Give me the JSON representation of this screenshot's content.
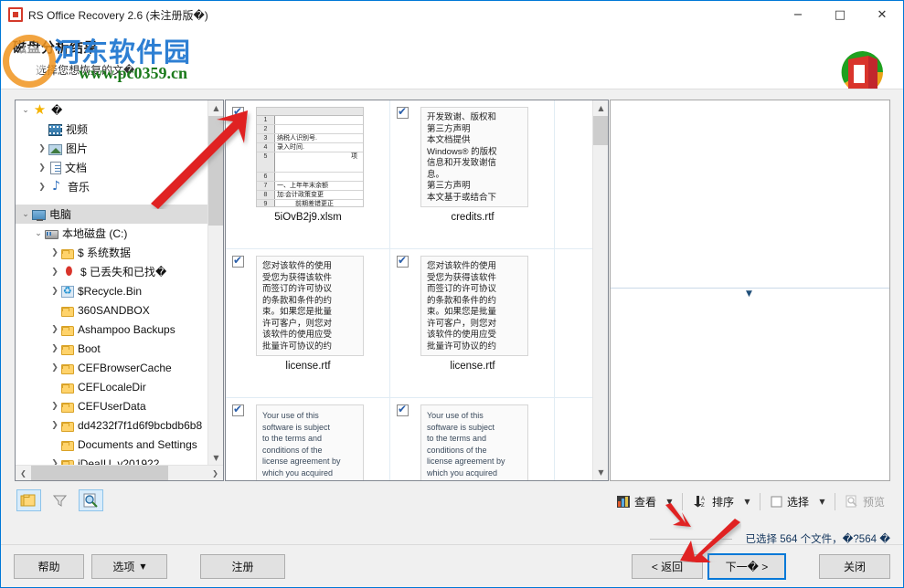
{
  "window": {
    "title": "RS Office Recovery 2.6 (未注册版�)",
    "icon": "office-recovery-icon",
    "minimize": "−",
    "maximize": "□",
    "close": "✕"
  },
  "header": {
    "title": "磁盘分析结果",
    "subtitle": "选择您想恢复的文�",
    "logo": "rs-office-recovery-logo"
  },
  "watermark": {
    "line1": "河东软件园",
    "line2": "www.pc0359.cn"
  },
  "tree": {
    "items": [
      {
        "label": "",
        "indent": 0,
        "chevron": "v",
        "icon": "star-icon",
        "selected": false,
        "unknown": "�"
      },
      {
        "label": "视频",
        "indent": 1,
        "chevron": "",
        "icon": "video-icon",
        "selected": false
      },
      {
        "label": "图片",
        "indent": 1,
        "chevron": ">",
        "icon": "picture-icon",
        "selected": false
      },
      {
        "label": "文档",
        "indent": 1,
        "chevron": ">",
        "icon": "document-icon",
        "selected": false
      },
      {
        "label": "音乐",
        "indent": 1,
        "chevron": ">",
        "icon": "music-icon",
        "selected": false
      },
      {
        "label": "电脑",
        "indent": 0,
        "chevron": "v",
        "icon": "computer-icon",
        "selected": true
      },
      {
        "label": "本地磁盘 (C:)",
        "indent": 1,
        "chevron": "v",
        "icon": "disk-icon",
        "selected": false
      },
      {
        "label": "$ 系统数据",
        "indent": 2,
        "chevron": ">",
        "icon": "folder-icon",
        "selected": false
      },
      {
        "label": "$ 已丢失和已找�",
        "indent": 2,
        "chevron": ">",
        "icon": "puzzle-icon",
        "selected": false
      },
      {
        "label": "$Recycle.Bin",
        "indent": 2,
        "chevron": ">",
        "icon": "recycle-bin-icon",
        "selected": false
      },
      {
        "label": "360SANDBOX",
        "indent": 2,
        "chevron": "",
        "icon": "folder-icon",
        "selected": false
      },
      {
        "label": "Ashampoo Backups",
        "indent": 2,
        "chevron": ">",
        "icon": "folder-icon",
        "selected": false
      },
      {
        "label": "Boot",
        "indent": 2,
        "chevron": ">",
        "icon": "folder-icon",
        "selected": false
      },
      {
        "label": "CEFBrowserCache",
        "indent": 2,
        "chevron": ">",
        "icon": "folder-icon",
        "selected": false
      },
      {
        "label": "CEFLocaleDir",
        "indent": 2,
        "chevron": "",
        "icon": "folder-icon",
        "selected": false
      },
      {
        "label": "CEFUserData",
        "indent": 2,
        "chevron": ">",
        "icon": "folder-icon",
        "selected": false
      },
      {
        "label": "dd4232f7f1d6f9bcbdb6b8",
        "indent": 2,
        "chevron": ">",
        "icon": "folder-icon",
        "selected": false
      },
      {
        "label": "Documents and Settings",
        "indent": 2,
        "chevron": "",
        "icon": "folder-icon",
        "selected": false
      },
      {
        "label": "iDeaIU_v201922",
        "indent": 2,
        "chevron": ">",
        "icon": "folder-icon",
        "selected": false
      }
    ]
  },
  "thumbnails": [
    {
      "name": "5iOvB2j9.xlsm",
      "type": "excel",
      "checked": true,
      "rows": [
        {
          "n": "1",
          "text": ""
        },
        {
          "n": "2",
          "text": ""
        },
        {
          "n": "3",
          "text": "纳税人识别号."
        },
        {
          "n": "4",
          "text": "录入时间."
        },
        {
          "n": "5",
          "text": ""
        },
        {
          "n": "6",
          "text": "项",
          "align": "right"
        },
        {
          "n": "7",
          "text": "一、上年年末余额"
        },
        {
          "n": "8",
          "text": "加:会计政策变更"
        },
        {
          "n": "9",
          "text": "前期差错更正",
          "align": "indent"
        }
      ]
    },
    {
      "name": "credits.rtf",
      "type": "text-cn",
      "checked": true,
      "text": "开发致谢、版权和\n第三方声明\n本文档提供\nWindows® 的版权\n信息和开发致谢信\n息。\n第三方声明\n本文基于或结合下"
    },
    {
      "name": "license.rtf",
      "type": "text-cn",
      "checked": true,
      "text": "您对该软件的使用\n受您为获得该软件\n而签订的许可协议\n的条款和条件的约\n束。如果您是批量\n许可客户，则您对\n该软件的使用应受\n批量许可协议的约"
    },
    {
      "name": "license.rtf",
      "type": "text-cn",
      "checked": true,
      "text": "您对该软件的使用\n受您为获得该软件\n而签订的许可协议\n的条款和条件的约\n束。如果您是批量\n许可客户，则您对\n该软件的使用应受\n批量许可协议的约"
    },
    {
      "name": "",
      "type": "text-en",
      "checked": true,
      "text": "Your use of this\nsoftware is subject\nto the terms and\nconditions of the\nlicense agreement by\nwhich you acquired"
    },
    {
      "name": "",
      "type": "text-en",
      "checked": true,
      "text": "Your use of this\nsoftware is subject\nto the terms and\nconditions of the\nlicense agreement by\nwhich you acquired"
    }
  ],
  "toolbar_left": [
    {
      "name": "group-files-button",
      "icon": "stacked-folders-icon",
      "active": true
    },
    {
      "name": "filter-button",
      "icon": "funnel-filter-icon",
      "active": false
    },
    {
      "name": "find-button",
      "icon": "page-magnifier-icon",
      "active": true
    }
  ],
  "toolbar_right": {
    "view": {
      "label": "查看",
      "icon": "view-thumbnails-icon",
      "caret": "▼"
    },
    "sort": {
      "label": "排序",
      "icon": "sort-az-icon",
      "caret": "▼"
    },
    "select": {
      "label": "选择",
      "icon": "checkbox-square-icon",
      "caret": "▼"
    },
    "preview": {
      "label": "预览",
      "icon": "preview-magnifier-icon",
      "disabled": true
    }
  },
  "status": {
    "text": "已选择 564 个文件，�?564 �"
  },
  "footer": {
    "help": "帮助",
    "options": "选项",
    "options_caret": "▼",
    "register": "注册",
    "back": "< 返回",
    "next": "下一� >",
    "close": "关闭"
  },
  "colors": {
    "accent": "#0078d7",
    "window_border": "#0078d7",
    "check": "#2b5faa",
    "status_text": "#14365d",
    "annotation_arrow": "#e02020"
  }
}
